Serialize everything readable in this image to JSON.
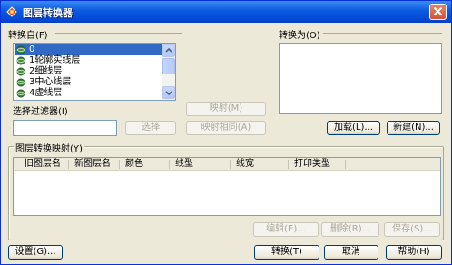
{
  "window": {
    "title": "图层转换器"
  },
  "source": {
    "label": "转换自(F)",
    "layers": [
      {
        "name": "0",
        "selected": true
      },
      {
        "name": "1轮廓实线层",
        "selected": false
      },
      {
        "name": "2细线层",
        "selected": false
      },
      {
        "name": "3中心线层",
        "selected": false
      },
      {
        "name": "4虚线层",
        "selected": false
      }
    ],
    "filter_label": "选择过滤器(I)",
    "filter_value": "",
    "select_button": "选择"
  },
  "target": {
    "label": "转换为(O)",
    "load_button": "加载(L)...",
    "new_button": "新建(N)..."
  },
  "middle": {
    "map_button": "映射(M)",
    "map_same_button": "映射相同(A)"
  },
  "mapping": {
    "label": "图层转换映射(Y)",
    "columns": [
      "旧图层名",
      "新图层名",
      "颜色",
      "线型",
      "线宽",
      "打印类型"
    ],
    "edit_button": "编辑(E)...",
    "delete_button": "删除(R)...",
    "save_button": "保存(S)..."
  },
  "footer": {
    "settings_button": "设置(G)...",
    "convert_button": "转换(T)",
    "cancel_button": "取消",
    "help_button": "帮助(H)"
  },
  "colors": {
    "title_blue": "#0a5ae0",
    "selection": "#316ac5",
    "dialog_bg": "#ece9d8",
    "layer_icon": "#3c8c3c"
  },
  "icons": {
    "layer": "layer-sphere-icon",
    "close": "close-icon",
    "app": "app-icon"
  }
}
